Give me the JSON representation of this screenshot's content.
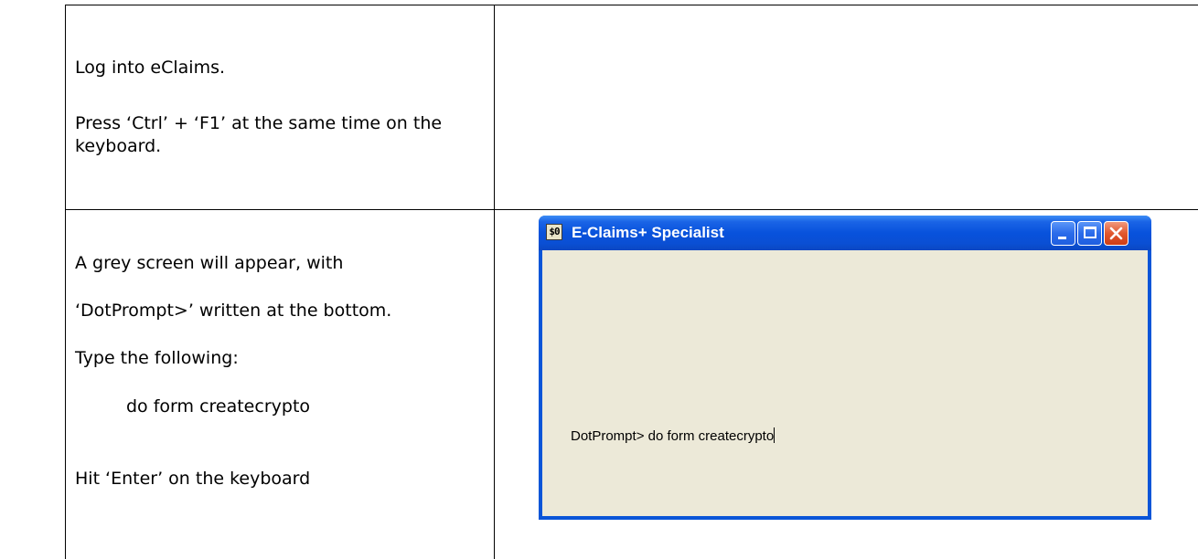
{
  "step1": {
    "line1": "Log into eClaims.",
    "line2": "Press ‘Ctrl’ + ‘F1’ at the same time on the keyboard."
  },
  "step2": {
    "line1": "A grey screen will appear, with",
    "line2": "‘DotPrompt>’ written at the bottom.",
    "line3": "Type the following:",
    "command": "do form createcrypto",
    "line4": "Hit ‘Enter’ on the keyboard"
  },
  "window": {
    "title": "E-Claims+ Specialist",
    "icon": "app-icon",
    "buttons": [
      "minimize",
      "maximize",
      "close"
    ],
    "prompt_text": "DotPrompt> do form createcrypto"
  }
}
